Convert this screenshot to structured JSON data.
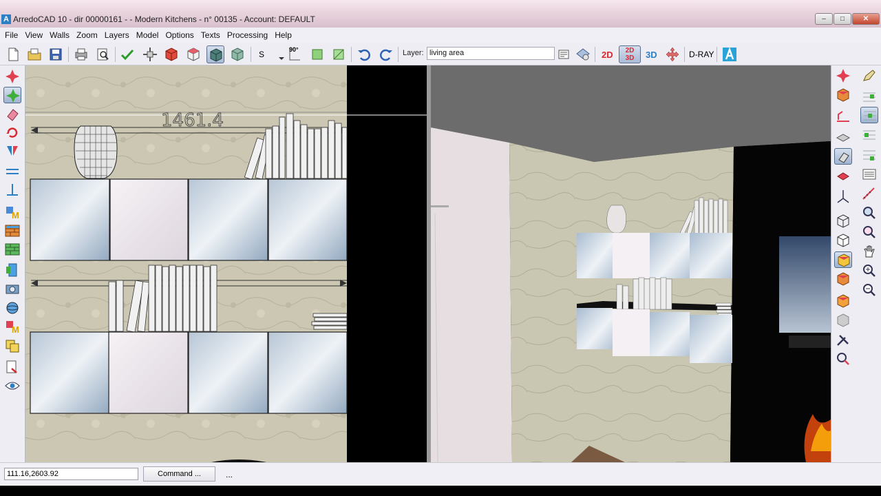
{
  "window": {
    "title": "ArredoCAD 10 - dir 00000161 -  - Modern Kitchens - n° 00135 - Account: DEFAULT",
    "app_logo": "A",
    "controls": [
      "minimize",
      "maximize",
      "close"
    ]
  },
  "menu": [
    "File",
    "View",
    "Walls",
    "Zoom",
    "Layers",
    "Model",
    "Options",
    "Texts",
    "Processing",
    "Help"
  ],
  "toolbar": {
    "layer_label": "Layer:",
    "layer_value": "living area",
    "s_label": "S",
    "angle_label": "90°",
    "view_2d": "2D",
    "view_2d3d": "2D 3D",
    "view_3d": "3D",
    "dray_label": "D-RAY",
    "icons": [
      "new-file-icon",
      "open-folder-icon",
      "save-icon",
      "print-icon",
      "print-preview-icon",
      "check-icon",
      "move-icon",
      "cube-red-icon",
      "cube-outline-icon",
      "cube-dark-icon",
      "cube-green-icon",
      "snap-dropdown-icon",
      "snap-green-icon",
      "snap-green2-icon",
      "undo-icon",
      "redo-icon",
      "layer-props-icon",
      "layer-settings-icon",
      "pan-icon",
      "arredocad-logo-icon"
    ]
  },
  "left_panel_icons": [
    "star-icon",
    "select-icon",
    "eraser-icon",
    "rotate-icon",
    "mirror-icon",
    "parallel-icon",
    "perpendicular-icon",
    "material-m-icon",
    "brick-wall-icon",
    "brick-red-icon",
    "door-icon",
    "camera-icon",
    "sphere-icon",
    "material-m2-icon",
    "copy-icon",
    "export-icon",
    "eye-icon"
  ],
  "right_panel_icons": [
    "star-icon",
    "cube-box-icon",
    "pencil-icon",
    "layer-grid-icon",
    "wall-icon",
    "snap-grid-icon",
    "floor-icon",
    "snap-select-icon",
    "view-iso-icon",
    "snap-list-icon",
    "view-plan-icon",
    "snap-list2-icon",
    "axis-icon",
    "measure-icon",
    "cube-wire-icon",
    "zoom-window-icon",
    "cube-white-icon",
    "zoom-fit-icon",
    "cube-yellow-icon",
    "pan-hand-icon",
    "cube-orange-icon",
    "zoom-in-icon",
    "cube-red2-icon",
    "zoom-out-icon",
    "cube-grey-icon",
    "tools-icon",
    "render-icon"
  ],
  "viewport2d": {
    "dimension_label": "1461.4"
  },
  "statusbar": {
    "coords": "111.16,2603.92",
    "command_label": "Command ...",
    "ellipsis": "..."
  },
  "colors": {
    "accent_blue": "#2b7fc4",
    "wall_stone": "#c8c3ae",
    "ceiling_grey": "#6c6c6c"
  }
}
